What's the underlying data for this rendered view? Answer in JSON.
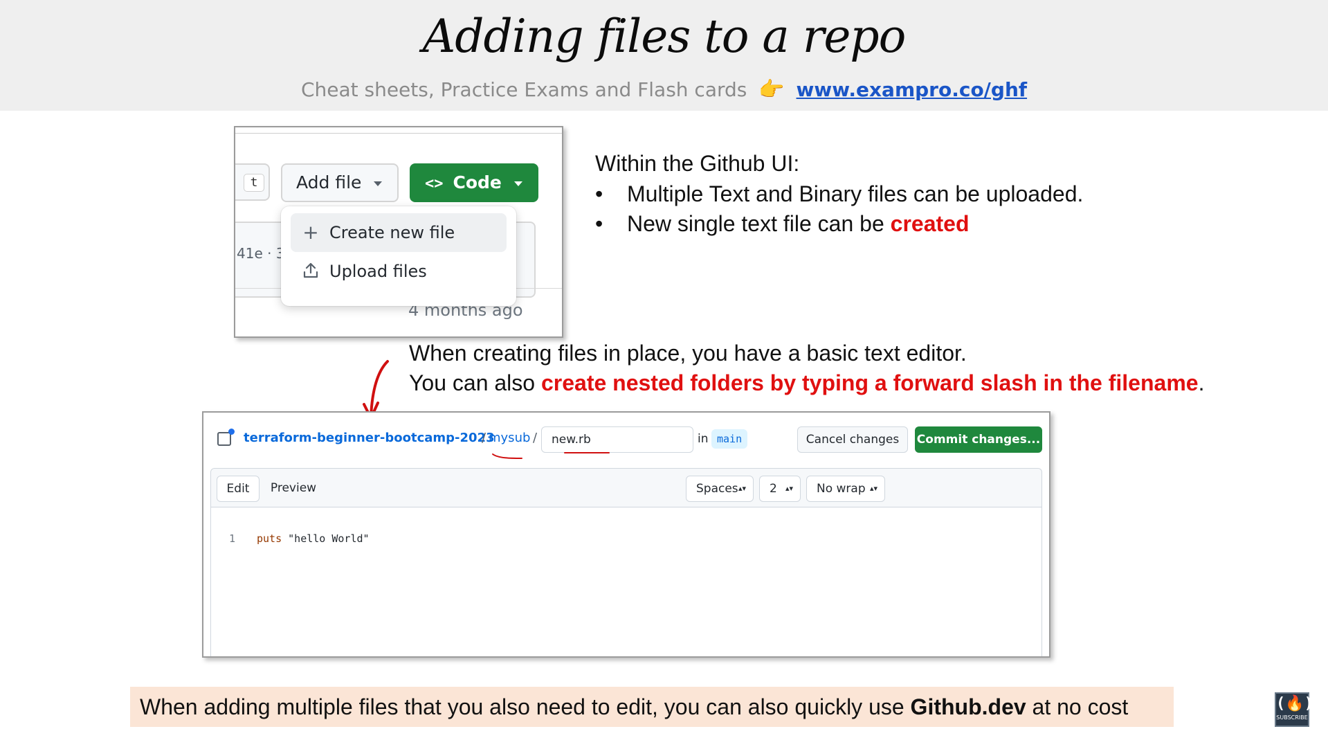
{
  "slide": {
    "title": "Adding files to a repo",
    "subline_text": "Cheat sheets, Practice Exams and Flash cards",
    "subline_icon": "pointing-hand-icon",
    "subline_link": "www.exampro.co/ghf"
  },
  "github_menu": {
    "t_chip": "t",
    "add_file": "Add file",
    "code": "Code",
    "code_icon": "<>",
    "hash_text": "41e · 3",
    "months_ago": "4 months ago",
    "items": [
      {
        "icon": "+",
        "label": "Create new file"
      },
      {
        "icon": "upload-icon",
        "label": "Upload files"
      }
    ]
  },
  "notes": {
    "heading": "Within the Github UI:",
    "bullet_symbol": "•",
    "bullet1": "Multiple Text and Binary files can be uploaded.",
    "bullet2_prefix": "New single text file can be ",
    "bullet2_emph": "created",
    "para1": "When creating files in place, you have a basic text editor.",
    "para2_prefix": "You can also ",
    "para2_emph": "create nested folders by typing a forward slash in the  filename",
    "para2_suffix": "."
  },
  "editor": {
    "repo": "terraform-beginner-bootcamp-2023",
    "sep1": "/",
    "subfolder": "mysub",
    "sep2": "/",
    "filename": "new.rb",
    "in_label": "in",
    "branch": "main",
    "cancel": "Cancel changes",
    "commit": "Commit changes...",
    "tab_edit": "Edit",
    "tab_preview": "Preview",
    "indent_mode": "Spaces",
    "indent_size": "2",
    "wrap_mode": "No wrap",
    "line_number": "1",
    "code_keyword": "puts",
    "code_string": " \"hello World\""
  },
  "banner": {
    "prefix": "When adding multiple files that you also need to edit, you can also quickly use ",
    "emph": "Github.dev",
    "suffix": " at no cost"
  },
  "logo": {
    "sub": "SUBSCRIBE"
  },
  "colors": {
    "accent_red": "#e01010",
    "github_green": "#1f883d",
    "link_blue": "#0969da",
    "banner_bg": "#fbe5d6",
    "header_bg": "#efefef"
  }
}
